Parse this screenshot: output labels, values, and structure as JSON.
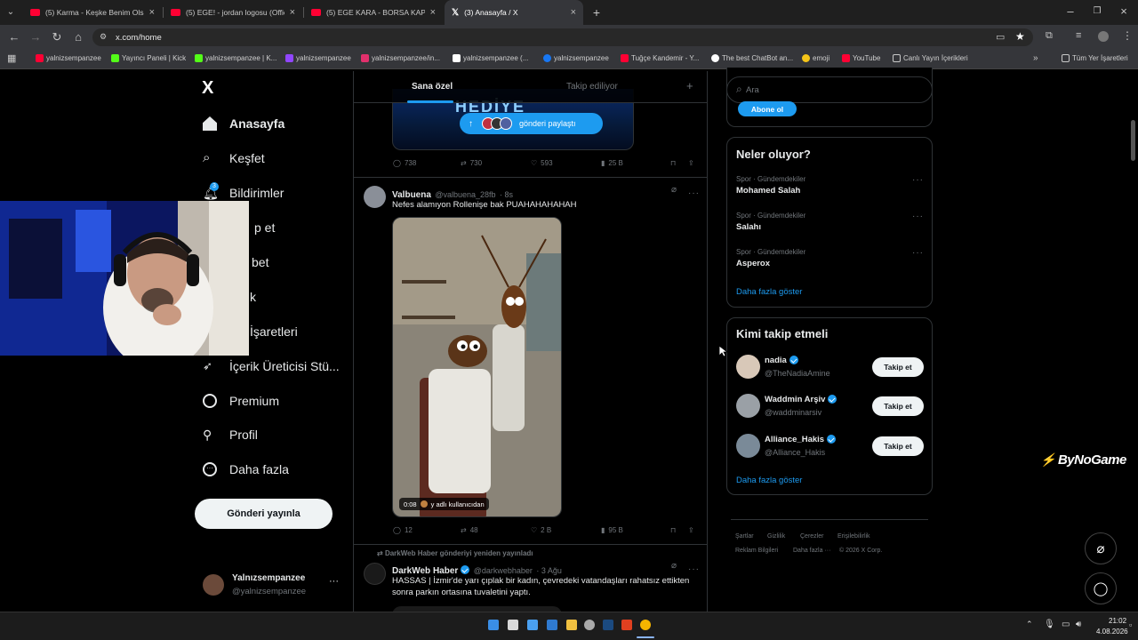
{
  "browser": {
    "tabs": [
      {
        "title": "(5) Karma - Keşke Benim Olsa (",
        "active": false
      },
      {
        "title": "(5) EGE! - jordan logosu (Offici",
        "active": false
      },
      {
        "title": "(5) EGE KARA - BORSA KAPLAN",
        "active": false
      },
      {
        "title": "(3) Anasayfa / X",
        "active": true
      }
    ],
    "new_tab": "+",
    "url": "x.com/home",
    "bookmarks": [
      {
        "label": "yalnizsempanzee",
        "icon": "youtube-icon",
        "color": "#ff0033"
      },
      {
        "label": "Yayıncı Paneli | Kick",
        "icon": "kick-icon",
        "color": "#53fc18"
      },
      {
        "label": "yalnizsempanzee | K...",
        "icon": "kick-icon",
        "color": "#53fc18"
      },
      {
        "label": "yalnizsempanzee",
        "icon": "twitch-icon",
        "color": "#9146ff"
      },
      {
        "label": "yalnizsempanzee/in...",
        "icon": "instagram-icon",
        "color": "#e1306c"
      },
      {
        "label": "yalnizsempanzee (...",
        "icon": "tiktok-icon",
        "color": "#ffffff"
      },
      {
        "label": "yalnizsempanzee",
        "icon": "facebook-icon",
        "color": "#1877f2"
      },
      {
        "label": "Tuğçe Kandemir - Y...",
        "icon": "youtube-icon",
        "color": "#ff0033"
      },
      {
        "label": "The best ChatBot an...",
        "icon": "chatbot-icon",
        "color": "#ffffff"
      },
      {
        "label": "emoji",
        "icon": "emoji-icon",
        "color": "#f5c518"
      },
      {
        "label": "YouTube",
        "icon": "youtube-icon",
        "color": "#ff0033"
      },
      {
        "label": "Canlı Yayın İçerikleri",
        "icon": "folder-icon",
        "color": "#c8c8c8"
      }
    ],
    "all_bookmarks": "Tüm Yer İşaretleri"
  },
  "sidebar": {
    "logo": "X",
    "notif_badge": "3",
    "items": [
      {
        "label": "Anasayfa",
        "icon": "home-icon",
        "bold": true
      },
      {
        "label": "Keşfet",
        "icon": "search-icon"
      },
      {
        "label": "Bildirimler",
        "icon": "bell-icon"
      },
      {
        "label": "p et",
        "icon": "follow-icon"
      },
      {
        "label": "bet",
        "icon": "chat-icon"
      },
      {
        "label": "k",
        "icon": "grok-icon"
      },
      {
        "label": "İşaretleri",
        "icon": "bookmark-icon"
      },
      {
        "label": "İçerik Üreticisi Stü...",
        "icon": "rocket-icon"
      },
      {
        "label": "Premium",
        "icon": "premium-icon"
      },
      {
        "label": "Profil",
        "icon": "profile-icon"
      },
      {
        "label": "Daha fazla",
        "icon": "more-circle-icon"
      }
    ],
    "post_button": "Gönderi yayınla",
    "account": {
      "name": "Yalnızsempanzee",
      "handle": "@yalnizsempanzee",
      "more": "···"
    }
  },
  "feed": {
    "tabs": [
      "Sana özel",
      "Takip ediliyor"
    ],
    "add": "+",
    "post1": {
      "banner_text": "HEDİYE",
      "share_pill": "gönderi paylaştı",
      "stats": {
        "replies": "738",
        "reposts": "730",
        "likes": "593",
        "views": "25 B"
      }
    },
    "post2": {
      "name": "Valbuena",
      "handle": "@valbuena_28fb",
      "time": "· 8s",
      "text": "Nefes alamıyon Rollenişe bak PUAHAHAHAHAH",
      "video_time": "0:08",
      "video_credit": "y adlı kullanıcıdan",
      "stats": {
        "replies": "12",
        "reposts": "48",
        "likes": "2 B",
        "views": "95 B"
      }
    },
    "post3": {
      "repost_label": "DarkWeb Haber gönderiyi yeniden yayınladı",
      "name": "DarkWeb Haber",
      "handle": "@darkwebhaber",
      "time": "· 3 Ağu",
      "text": "HASSAS | İzmir'de yarı çıplak bir kadın, çevredeki vatandaşları rahatsız ettikten sonra parkın ortasına tuvaletini yaptı."
    }
  },
  "right": {
    "search_placeholder": "Ara",
    "subscribe": "Abone ol",
    "trends_title": "Neler oluyor?",
    "trends": [
      {
        "category": "Spor · Gündemdekiler",
        "name": "Mohamed Salah"
      },
      {
        "category": "Spor · Gündemdekiler",
        "name": "Salahı"
      },
      {
        "category": "Spor · Gündemdekiler",
        "name": "Asperox"
      }
    ],
    "show_more": "Daha fazla göster",
    "who_title": "Kimi takip etmeli",
    "who": [
      {
        "name": "nadia",
        "handle": "@TheNadiaAmine",
        "button": "Takip et"
      },
      {
        "name": "Waddmin Arşiv",
        "handle": "@waddminarsiv",
        "button": "Takip et"
      },
      {
        "name": "Alliance_Hakis",
        "handle": "@Alliance_Hakis",
        "button": "Takip et"
      }
    ],
    "who_more": "Daha fazla göster",
    "footer": [
      "Şartlar",
      "Gizlilik",
      "Çerezler",
      "Erişilebilirlik",
      "Reklam Bilgileri",
      "Daha fazla ···",
      "© 2026 X Corp."
    ]
  },
  "watermark": "ByNoGame",
  "taskbar": {
    "time": "21:02",
    "date": "4.08.2026"
  },
  "colors": {
    "accent": "#1d9bf0",
    "youtube": "#ff0033",
    "kick": "#53fc18"
  }
}
